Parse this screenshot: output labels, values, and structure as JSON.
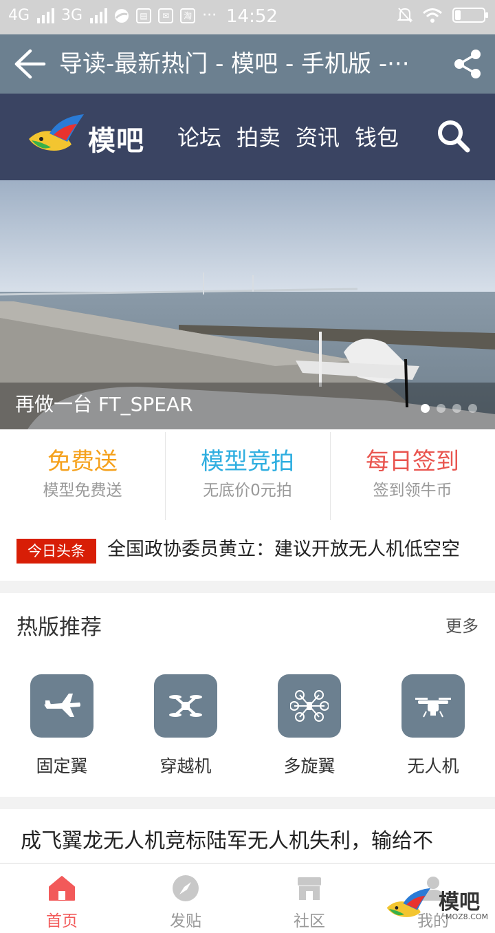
{
  "status_bar": {
    "network_left": "4G",
    "network_right": "3G",
    "more": "···",
    "time": "14:52"
  },
  "title_bar": {
    "title": "导读-最新热门 - 模吧 - 手机版 -···"
  },
  "site_header": {
    "logo_text": "模吧",
    "nav": [
      "论坛",
      "拍卖",
      "资讯",
      "钱包"
    ]
  },
  "banner": {
    "caption": "再做一台 FT_SPEAR",
    "slides": 4,
    "active_slide": 1
  },
  "features": [
    {
      "title": "免费送",
      "subtitle": "模型免费送",
      "color": "#f5a11c"
    },
    {
      "title": "模型竞拍",
      "subtitle": "无底价0元拍",
      "color": "#2eaee0"
    },
    {
      "title": "每日签到",
      "subtitle": "签到领牛币",
      "color": "#e9554f"
    }
  ],
  "headline": {
    "badge": "今日头条",
    "text": "全国政协委员黄立：建议开放无人机低空空"
  },
  "hot_boards": {
    "title": "热版推荐",
    "more": "更多",
    "items": [
      {
        "label": "固定翼",
        "icon": "fixed-wing-plane-icon"
      },
      {
        "label": "穿越机",
        "icon": "fpv-quad-icon"
      },
      {
        "label": "多旋翼",
        "icon": "multirotor-icon"
      },
      {
        "label": "无人机",
        "icon": "drone-icon"
      }
    ]
  },
  "article": {
    "title": "成飞翼龙无人机竞标陆军无人机失利，输给不"
  },
  "bottom_nav": {
    "tabs": [
      {
        "label": "首页",
        "icon": "home-icon",
        "active": true
      },
      {
        "label": "发贴",
        "icon": "compass-icon",
        "active": false
      },
      {
        "label": "社区",
        "icon": "store-icon",
        "active": false
      },
      {
        "label": "我的",
        "icon": "user-icon",
        "active": false
      }
    ]
  },
  "watermark": {
    "text": "模吧",
    "url": "MOZ8.COM"
  },
  "colors": {
    "title_bar": "#6c8090",
    "site_header": "#3a4462",
    "accent_red": "#d81e06",
    "active_tab": "#f25a5a"
  }
}
